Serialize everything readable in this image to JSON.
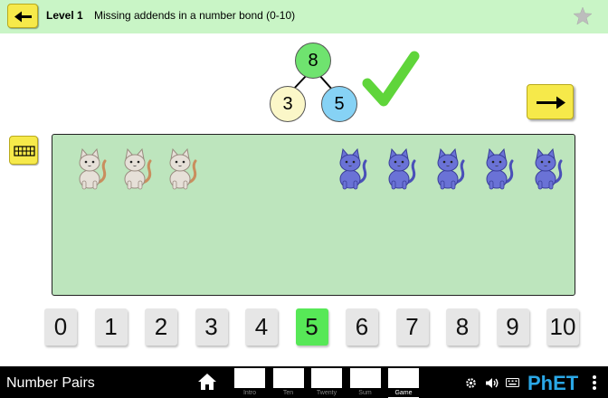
{
  "header": {
    "level": "Level 1",
    "description": "Missing addends in a number bond (0-10)"
  },
  "number_bond": {
    "total": "8",
    "left": "3",
    "right": "5"
  },
  "cats": {
    "left_count": 3,
    "right_count": 5,
    "left_color": "#e6e0d8",
    "right_color": "#6a72d6"
  },
  "number_buttons": [
    "0",
    "1",
    "2",
    "3",
    "4",
    "5",
    "6",
    "7",
    "8",
    "9",
    "10"
  ],
  "selected_number": "5",
  "navbar": {
    "sim_title": "Number Pairs",
    "screens": [
      "Intro",
      "Ten",
      "Twenty",
      "Sum",
      "Game"
    ],
    "active_screen": "Game",
    "logo": "PhET"
  },
  "colors": {
    "header_bg": "#c9f5c6",
    "button_yellow": "#f6e94a",
    "play_area": "#bde5bd",
    "selected_button": "#57e857",
    "check_green": "#5fd53a",
    "bond_total": "#6fe36f",
    "bond_left": "#fbf7c8",
    "bond_right": "#86d2f5"
  },
  "icons": [
    "arrow-left-icon",
    "star-icon",
    "check-icon",
    "arrow-right-icon",
    "grid-icon",
    "home-icon",
    "gear-icon",
    "speaker-icon",
    "keyboard-icon",
    "more-icon"
  ]
}
